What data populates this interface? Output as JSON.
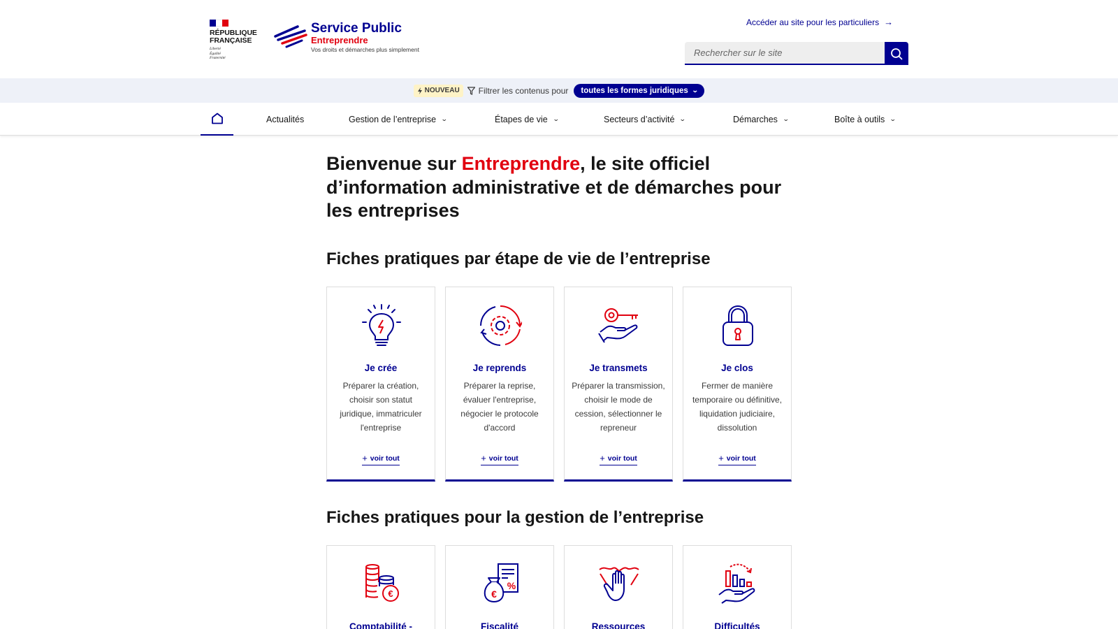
{
  "header": {
    "republique": "RÉPUBLIQUE\nFRANÇAISE",
    "devise": "Liberté\nÉgalité\nFraternité",
    "brand_title": "Service Public",
    "brand_sub": "Entreprendre",
    "brand_tag": "Vos droits et démarches plus simplement",
    "particuliers_link": "Accéder au site pour les particuliers",
    "search_placeholder": "Rechercher sur le site"
  },
  "filter": {
    "badge": "NOUVEAU",
    "text": "Filtrer les contenus pour",
    "selected": "toutes les formes juridiques"
  },
  "nav": {
    "items": [
      {
        "label": "Actualités"
      },
      {
        "label": "Gestion de l’entreprise"
      },
      {
        "label": "Étapes de vie"
      },
      {
        "label": "Secteurs d’activité"
      },
      {
        "label": "Démarches"
      },
      {
        "label": "Boîte à outils"
      }
    ]
  },
  "main": {
    "title_before": "Bienvenue sur ",
    "title_accent": "Entreprendre",
    "title_after": ", le site officiel d’information administrative et de démarches pour les entreprises",
    "section1_title": "Fiches pratiques par étape de vie de l’entreprise",
    "section2_title": "Fiches pratiques pour la gestion de l’entreprise",
    "cards": [
      {
        "title": "Je crée",
        "desc": "Préparer la création, choisir son statut juridique, immatriculer l'entreprise",
        "link": "voir tout",
        "icon": "lightbulb-icon"
      },
      {
        "title": "Je reprends",
        "desc": "Préparer la reprise, évaluer l'entreprise, négocier le protocole d'accord",
        "link": "voir tout",
        "icon": "gear-cycle-icon"
      },
      {
        "title": "Je transmets",
        "desc": "Préparer la transmission, choisir le mode de cession, sélectionner le repreneur",
        "link": "voir tout",
        "icon": "key-hand-icon"
      },
      {
        "title": "Je clos",
        "desc": "Fermer de manière temporaire ou définitive, liquidation judiciaire, dissolution",
        "link": "voir tout",
        "icon": "padlock-icon"
      }
    ],
    "cards2": [
      {
        "title": "Comptabilité -",
        "icon": "coins-euro-icon"
      },
      {
        "title": "Fiscalité",
        "icon": "money-bag-percent-icon"
      },
      {
        "title": "Ressources",
        "icon": "hands-icon"
      },
      {
        "title": "Difficultés",
        "icon": "falling-chart-hand-icon"
      }
    ]
  },
  "colors": {
    "blue": "#000091",
    "red": "#e1000f",
    "band": "#eef1f8"
  }
}
